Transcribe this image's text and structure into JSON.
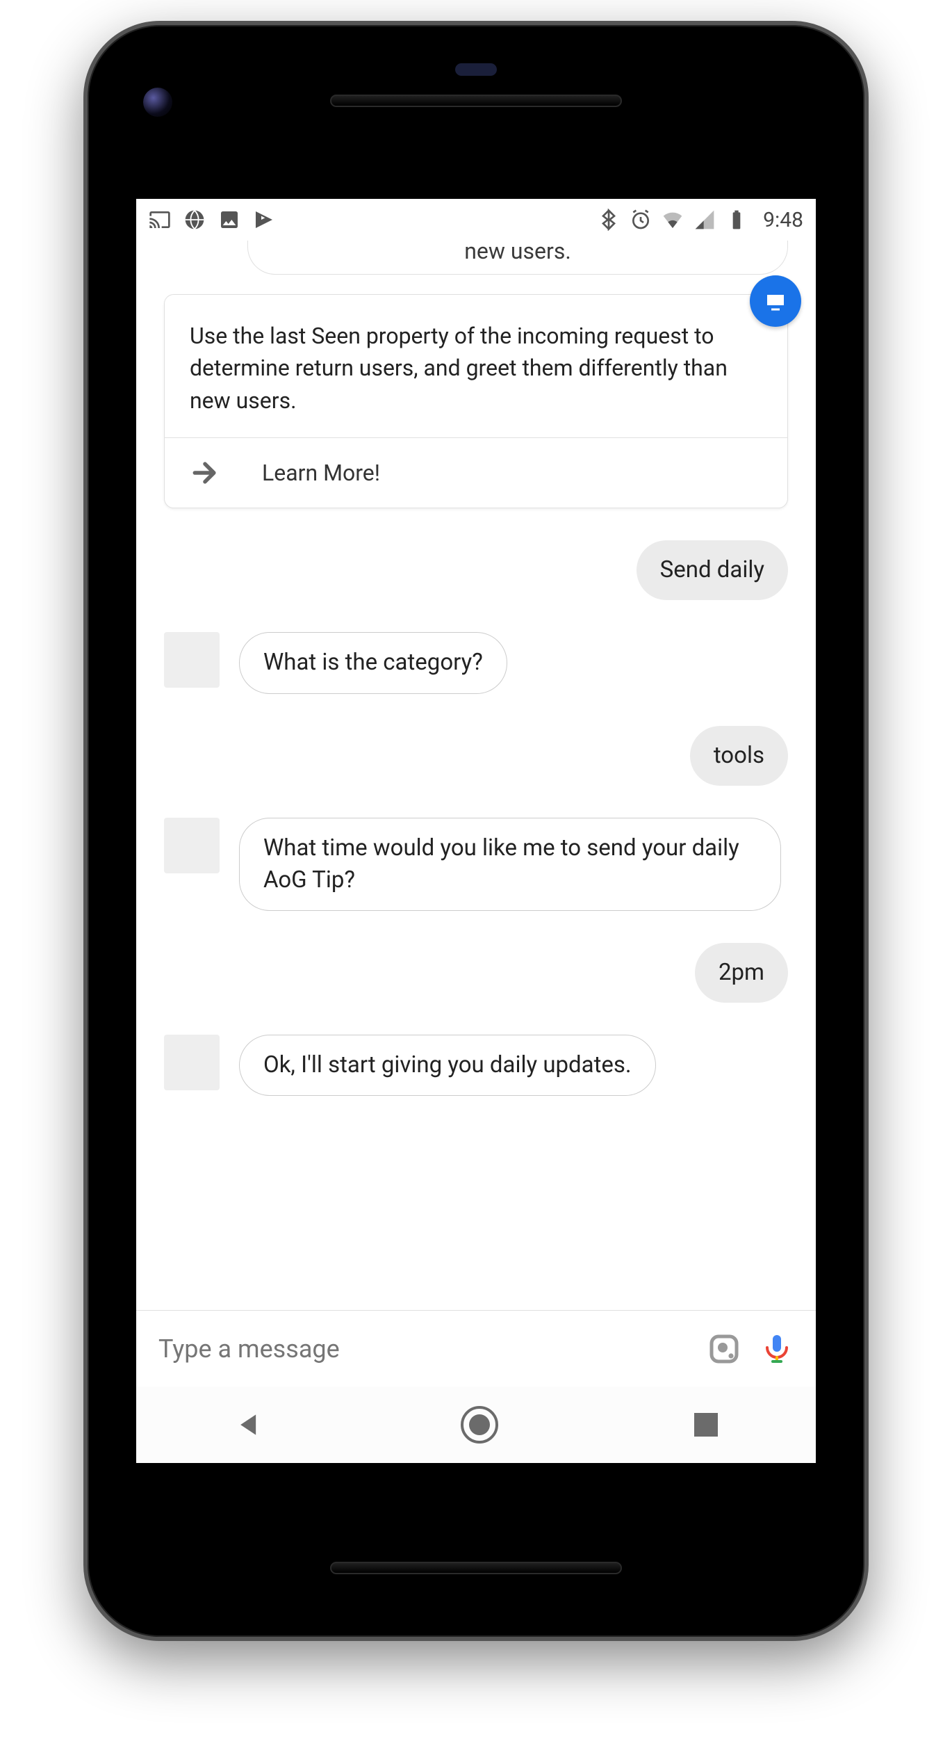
{
  "statusbar": {
    "time": "9:48",
    "left_icons": [
      "cast-icon",
      "sports-icon",
      "photos-icon",
      "play-icon"
    ],
    "right_icons": [
      "bluetooth-icon",
      "alarm-icon",
      "wifi-icon",
      "cell-icon",
      "battery-icon"
    ]
  },
  "peek_text": "new users.",
  "card": {
    "body": "Use the last Seen property of the incoming request to determine return users, and greet them differently than new users.",
    "action_label": "Learn More!",
    "badge_icon": "logo-icon"
  },
  "messages": [
    {
      "role": "user",
      "text": "Send daily"
    },
    {
      "role": "bot",
      "text": "What is the category?"
    },
    {
      "role": "user",
      "text": "tools"
    },
    {
      "role": "bot",
      "text": "What time would you like me to send your daily AoG Tip?"
    },
    {
      "role": "user",
      "text": "2pm"
    },
    {
      "role": "bot",
      "text": "Ok, I'll start giving you daily updates."
    }
  ],
  "input": {
    "placeholder": "Type a message"
  },
  "colors": {
    "accent": "#1a73e8",
    "user_bubble": "#ebebeb"
  }
}
